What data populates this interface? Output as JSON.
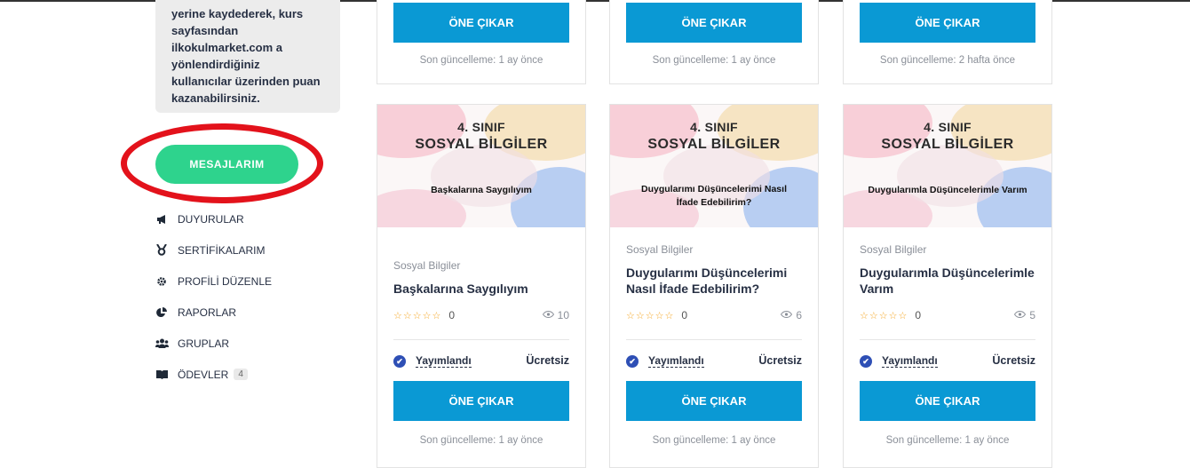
{
  "sidebar": {
    "info_lines": [
      "yerine kaydederek, kurs",
      "sayfasından",
      "ilkokulmarket.com a",
      "yönlendirdiğiniz",
      "kullanıcılar üzerinden puan",
      "kazanabilirsiniz."
    ],
    "messages_button": "MESAJLARIM",
    "menu": [
      {
        "label": "DUYURULAR",
        "icon": "megaphone-icon"
      },
      {
        "label": "SERTİFİKALARIM",
        "icon": "medal-icon"
      },
      {
        "label": "PROFİLİ DÜZENLE",
        "icon": "gear-icon"
      },
      {
        "label": "RAPORLAR",
        "icon": "pie-chart-icon"
      },
      {
        "label": "GRUPLAR",
        "icon": "users-icon"
      },
      {
        "label": "ÖDEVLER",
        "icon": "book-icon",
        "badge": "4"
      }
    ]
  },
  "top_cards": [
    {
      "button": "ÖNE ÇIKAR",
      "updated": "Son güncelleme: 1 ay önce"
    },
    {
      "button": "ÖNE ÇIKAR",
      "updated": "Son güncelleme: 1 ay önce"
    },
    {
      "button": "ÖNE ÇIKAR",
      "updated": "Son güncelleme: 2 hafta önce"
    }
  ],
  "courses": [
    {
      "thumb_grade": "4. SINIF",
      "thumb_subject": "SOSYAL BİLGİLER",
      "thumb_topic_lines": [
        "Başkalarına Saygılıyım"
      ],
      "category": "Sosyal Bilgiler",
      "title": "Başkalarına Saygılıyım",
      "stars": "☆☆☆☆☆",
      "rating": "0",
      "views": "10",
      "status": "Yayımlandı",
      "price": "Ücretsiz",
      "button": "ÖNE ÇIKAR",
      "updated": "Son güncelleme: 1 ay önce"
    },
    {
      "thumb_grade": "4. SINIF",
      "thumb_subject": "SOSYAL BİLGİLER",
      "thumb_topic_lines": [
        "Duygularımı Düşüncelerimi Nasıl",
        "İfade Edebilirim?"
      ],
      "category": "Sosyal Bilgiler",
      "title": "Duygularımı Düşüncelerimi Nasıl İfade Edebilirim?",
      "stars": "☆☆☆☆☆",
      "rating": "0",
      "views": "6",
      "status": "Yayımlandı",
      "price": "Ücretsiz",
      "button": "ÖNE ÇIKAR",
      "updated": "Son güncelleme: 1 ay önce"
    },
    {
      "thumb_grade": "4. SINIF",
      "thumb_subject": "SOSYAL BİLGİLER",
      "thumb_topic_lines": [
        "Duygularımla Düşüncelerimle Varım"
      ],
      "category": "Sosyal Bilgiler",
      "title": "Duygularımla Düşüncelerimle Varım",
      "stars": "☆☆☆☆☆",
      "rating": "0",
      "views": "5",
      "status": "Yayımlandı",
      "price": "Ücretsiz",
      "button": "ÖNE ÇIKAR",
      "updated": "Son güncelleme: 1 ay önce"
    }
  ],
  "colors": {
    "primary_button": "#0a99d4",
    "messages_button": "#2ed38d",
    "highlight_ellipse": "#e3121b",
    "star": "#f5a623",
    "check": "#2e4fb5"
  }
}
